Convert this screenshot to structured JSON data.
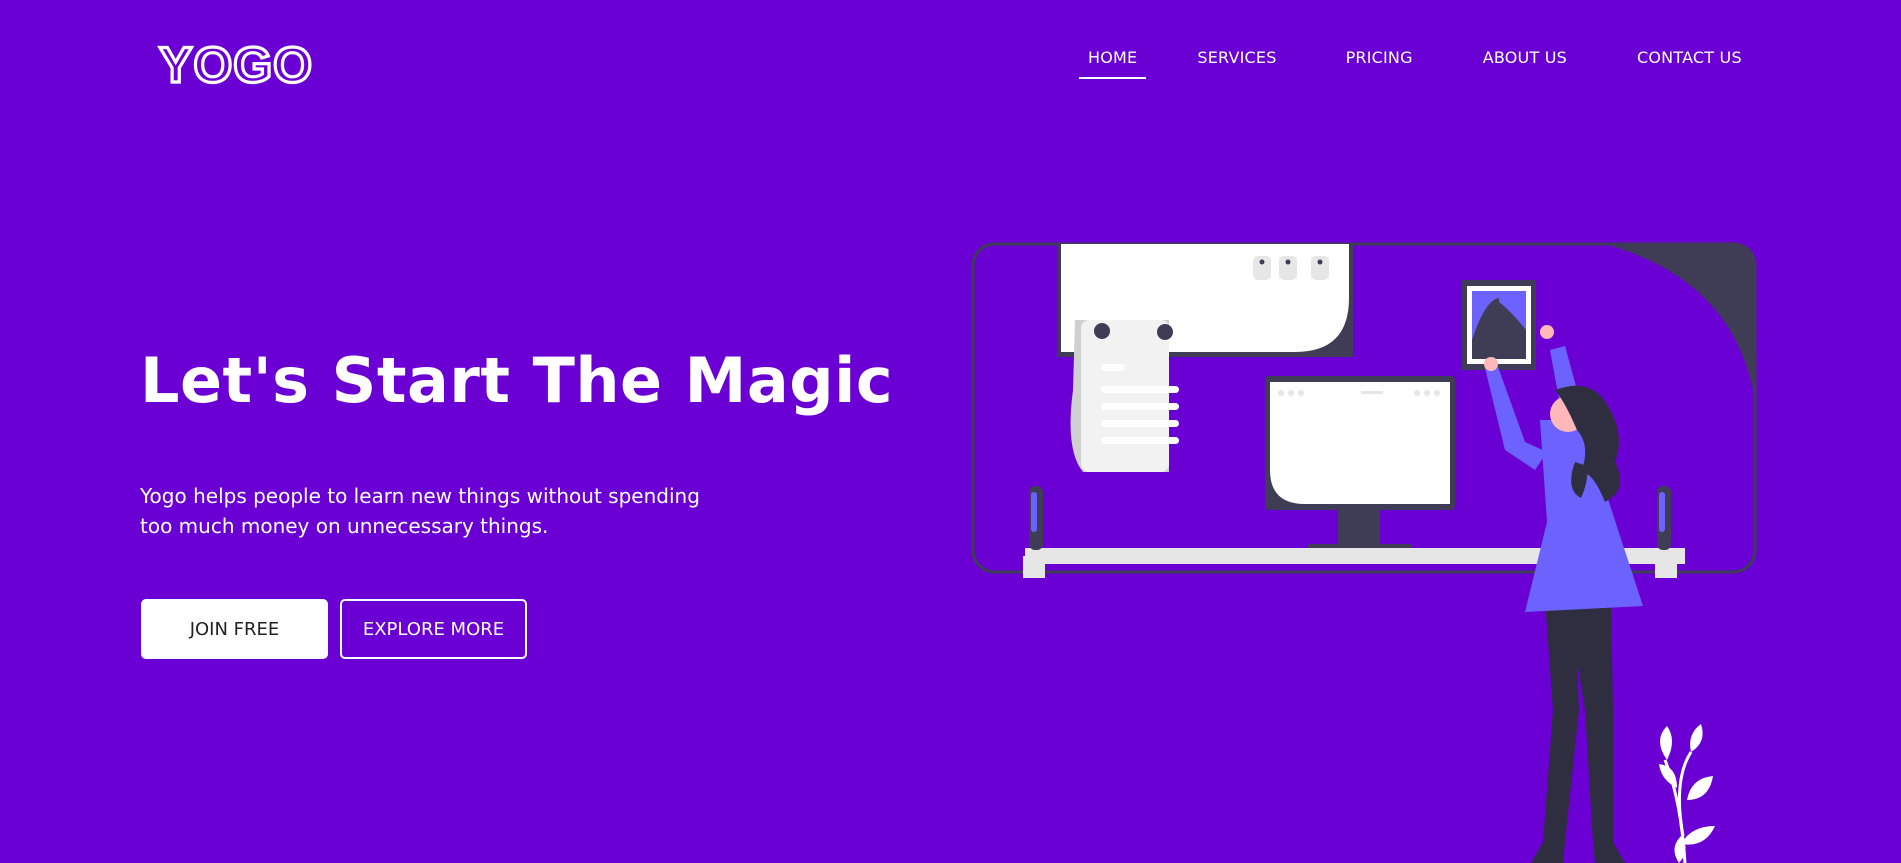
{
  "brand": {
    "logo_text": "YOGO"
  },
  "nav": {
    "items": [
      {
        "label": "HOME",
        "active": true
      },
      {
        "label": "SERVICES"
      },
      {
        "label": "PRICING"
      },
      {
        "label": "ABOUT US"
      },
      {
        "label": "CONTACT US"
      }
    ]
  },
  "hero": {
    "title": "Let's Start The Magic",
    "subtitle_line1": "Yogo helps people to learn new things without spending",
    "subtitle_line2": "too much money on unnecessary things.",
    "primary_button": "JOIN FREE",
    "secondary_button": "EXPLORE MORE"
  },
  "colors": {
    "background": "#6a00d4",
    "accent": "#6c63ff",
    "dark": "#2f2e41",
    "white": "#ffffff"
  }
}
